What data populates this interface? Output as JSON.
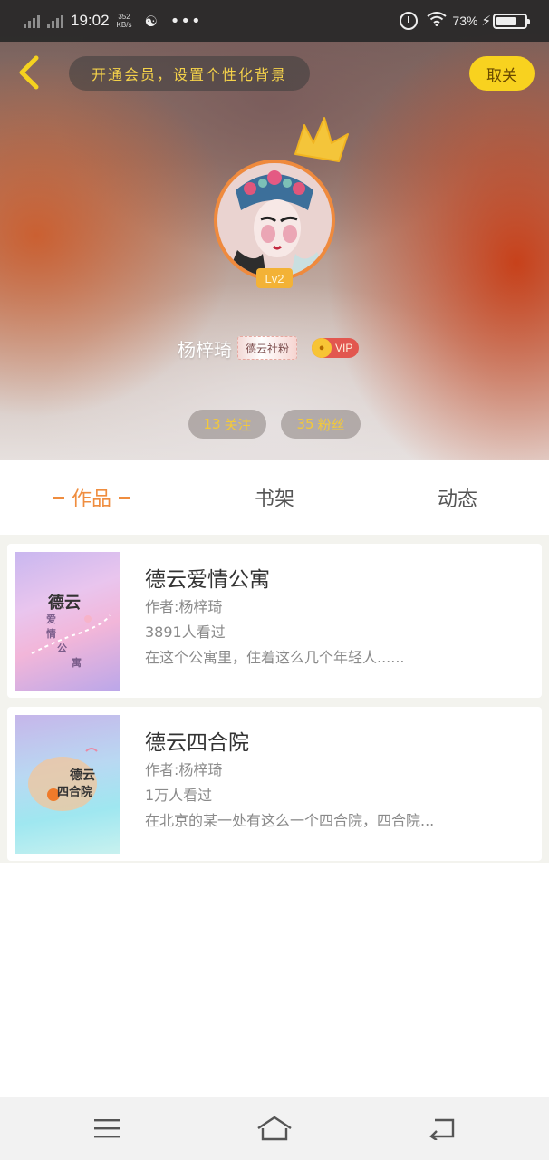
{
  "status_bar": {
    "time": "19:02",
    "net_speed_value": "352",
    "net_speed_unit": "KB/s",
    "more": "•••",
    "battery_pct": "73%",
    "battery_level": 0.73,
    "icons": [
      "signal-icon",
      "weibo-icon",
      "alarm-icon",
      "wifi-icon",
      "charging-icon",
      "battery-icon"
    ]
  },
  "header": {
    "vip_banner": "开通会员，设置个性化背景",
    "cancel_label": "取关",
    "level": "Lv2",
    "username": "杨梓琦",
    "tag": "德云社粉",
    "vip_label": "VIP",
    "follow_count": "13",
    "follow_label": "关注",
    "fans_count": "35",
    "fans_label": "粉丝"
  },
  "tabs": [
    {
      "label": "作品",
      "active": true
    },
    {
      "label": "书架",
      "active": false
    },
    {
      "label": "动态",
      "active": false
    }
  ],
  "works": [
    {
      "title": "德云爱情公寓",
      "author": "作者:杨梓琦",
      "views": "3891人看过",
      "desc": "在这个公寓里，住着这么几个年轻人......",
      "cover_text_a": "德云",
      "cover_text_b": "爱",
      "cover_text_c": "情",
      "cover_text_d": "公",
      "cover_text_e": "寓"
    },
    {
      "title": "德云四合院",
      "author": "作者:杨梓琦",
      "views": "1万人看过",
      "desc": "在北京的某一处有这么一个四合院，四合院...",
      "cover_text_a": "德云",
      "cover_text_b": "四合院"
    }
  ],
  "colors": {
    "accent": "#ef8d3f",
    "yellow": "#f8d21f",
    "vip_red": "#e2574f",
    "stat_text": "#f3c93a"
  },
  "navbar": {
    "icons": [
      "menu-icon",
      "home-icon",
      "back-icon"
    ]
  }
}
